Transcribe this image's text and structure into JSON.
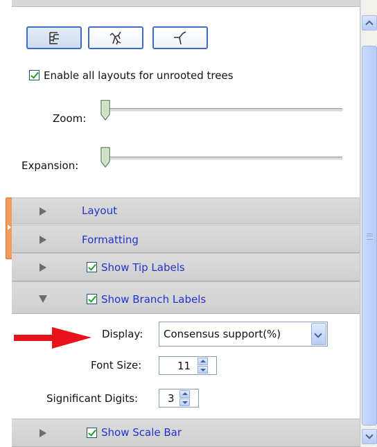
{
  "layout_buttons": [
    {
      "name": "rectangular-layout",
      "active": true
    },
    {
      "name": "radial-layout",
      "active": false
    },
    {
      "name": "unrooted-layout",
      "active": false
    }
  ],
  "enable_unrooted": {
    "label": "Enable all layouts for unrooted trees",
    "checked": true
  },
  "zoom": {
    "label": "Zoom:",
    "value": 0
  },
  "expansion": {
    "label": "Expansion:",
    "value": 0
  },
  "sections": {
    "layout": {
      "title": "Layout",
      "expanded": false
    },
    "formatting": {
      "title": "Formatting",
      "expanded": false
    },
    "tip_labels": {
      "title": "Show Tip Labels",
      "checked": true,
      "expanded": false
    },
    "branch_labels": {
      "title": "Show Branch Labels",
      "checked": true,
      "expanded": true
    },
    "scale_bar": {
      "title": "Show Scale Bar",
      "checked": true,
      "expanded": false
    }
  },
  "branch_label_settings": {
    "display_label": "Display:",
    "display_value": "Consensus support(%)",
    "font_size_label": "Font Size:",
    "font_size_value": "11",
    "sig_digits_label": "Significant Digits:",
    "sig_digits_value": "3"
  },
  "colors": {
    "accent": "#3f6ac4",
    "section_title": "#2233cc",
    "arrow": "#e8121b",
    "side_tab": "#f29b5a"
  }
}
